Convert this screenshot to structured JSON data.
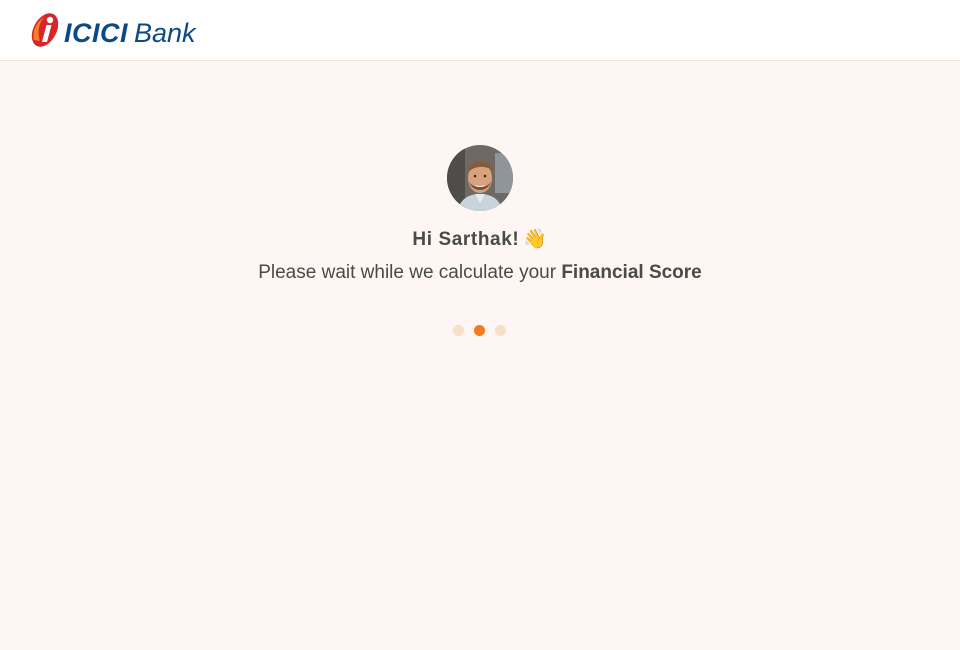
{
  "header": {
    "logo": {
      "brand_primary": "ICICI",
      "brand_secondary": "Bank",
      "colors": {
        "mark_red": "#d8242b",
        "mark_orange": "#f58220",
        "text_blue": "#0b4a86"
      }
    }
  },
  "main": {
    "avatar": {
      "icon": "user-avatar-photo"
    },
    "greeting": "Hi Sarthak!",
    "greeting_emoji": "👋",
    "subtitle_prefix": "Please wait while we calculate your ",
    "subtitle_bold": "Financial Score",
    "loader": {
      "dots": 3,
      "active_index": 1,
      "active_color": "#ef7c22",
      "inactive_color": "#f8ddc9"
    }
  },
  "colors": {
    "page_background": "#fdf6f3",
    "header_background": "#ffffff",
    "text": "#4a4a4a"
  }
}
